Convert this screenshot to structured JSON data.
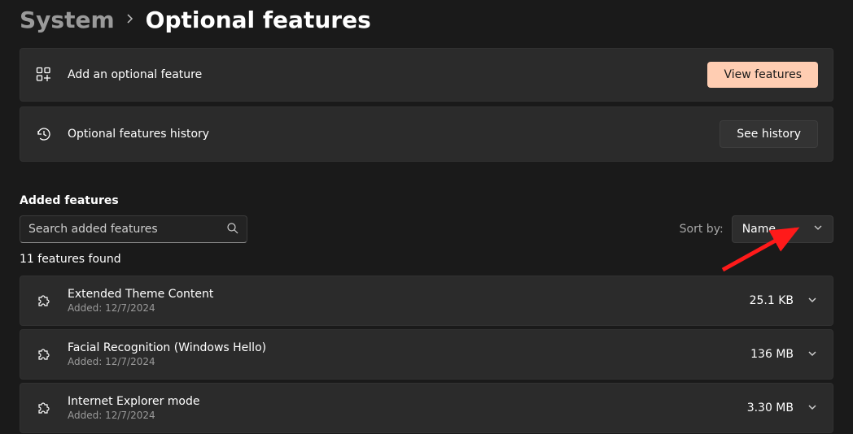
{
  "breadcrumb": {
    "parent": "System",
    "current": "Optional features"
  },
  "actions": {
    "add_label": "Add an optional feature",
    "view_features_btn": "View features",
    "history_label": "Optional features history",
    "see_history_btn": "See history"
  },
  "section": {
    "heading": "Added features",
    "search_placeholder": "Search added features",
    "sort_label": "Sort by:",
    "sort_value": "Name",
    "count_text": "11 features found"
  },
  "features": [
    {
      "name": "Extended Theme Content",
      "added": "Added: 12/7/2024",
      "size": "25.1 KB"
    },
    {
      "name": "Facial Recognition (Windows Hello)",
      "added": "Added: 12/7/2024",
      "size": "136 MB"
    },
    {
      "name": "Internet Explorer mode",
      "added": "Added: 12/7/2024",
      "size": "3.30 MB"
    }
  ]
}
